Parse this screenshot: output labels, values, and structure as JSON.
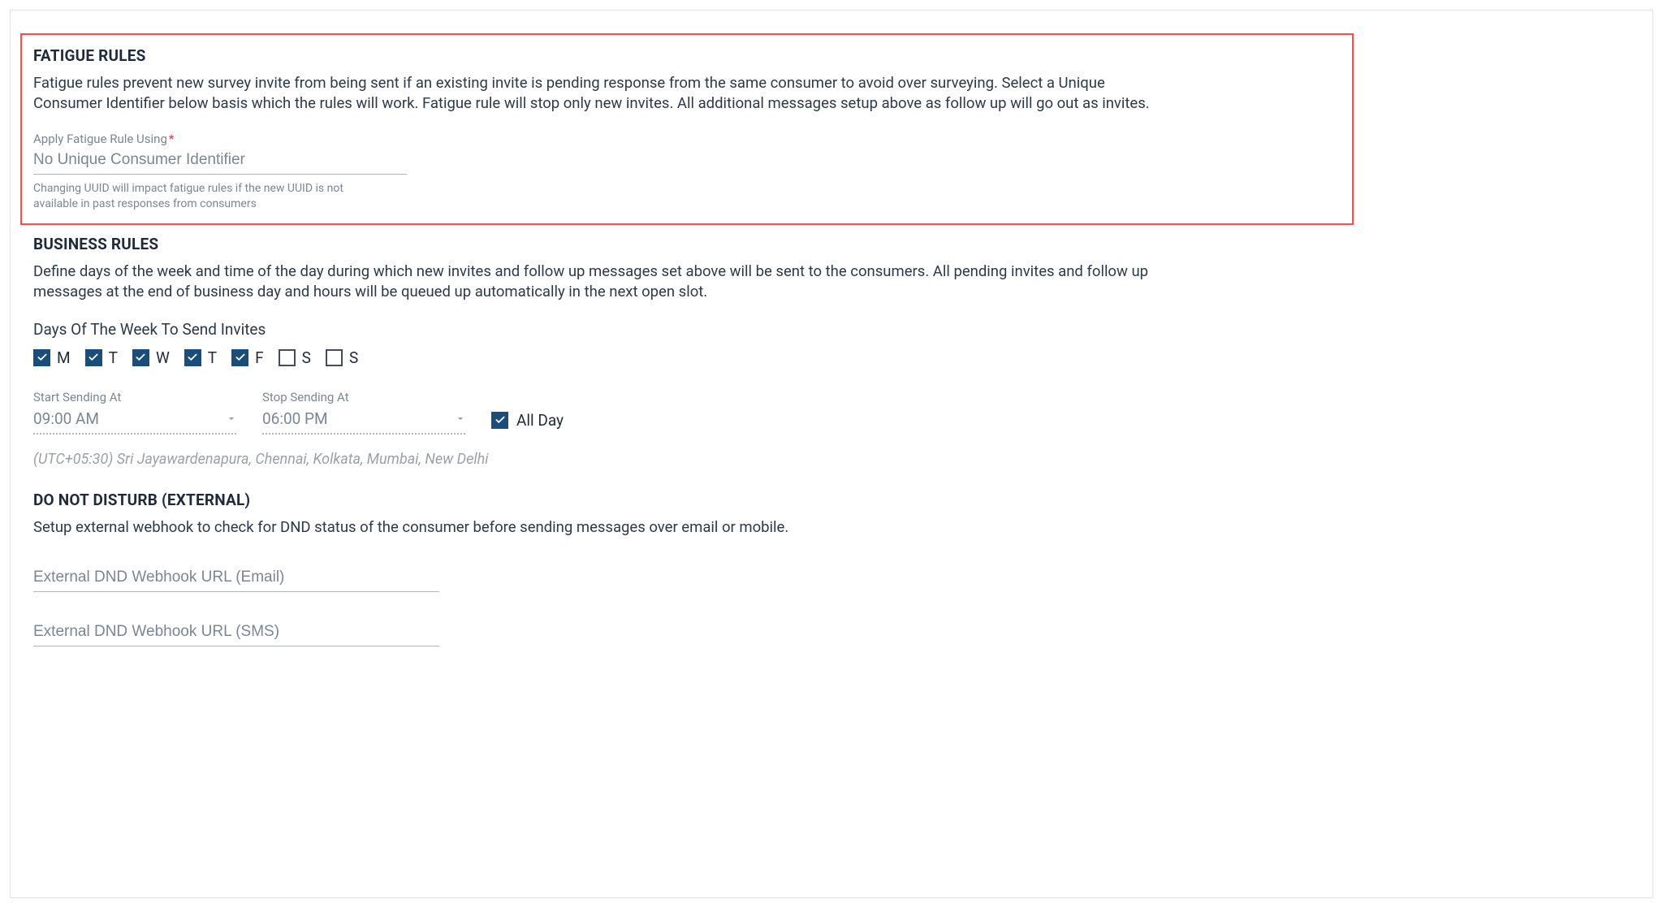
{
  "fatigue": {
    "title": "FATIGUE RULES",
    "description": "Fatigue rules prevent new survey invite from being sent if an existing invite is pending response from the same consumer to avoid over surveying. Select a Unique Consumer Identifier below basis which the rules will work. Fatigue rule will stop only new invites. All additional messages setup above as follow up will go out as invites.",
    "apply_label": "Apply Fatigue Rule Using",
    "apply_placeholder": "No Unique Consumer Identifier",
    "helper": "Changing UUID will impact fatigue rules if the new UUID is not available in past responses from consumers"
  },
  "business": {
    "title": "BUSINESS RULES",
    "description": "Define days of the week and time of the day during which new invites and follow up messages set above will be sent to the consumers. All pending invites and follow up messages at the end of business day and hours will be queued up automatically in the next open slot.",
    "days_label": "Days Of The Week To Send Invites",
    "days": [
      {
        "label": "M",
        "checked": true
      },
      {
        "label": "T",
        "checked": true
      },
      {
        "label": "W",
        "checked": true
      },
      {
        "label": "T",
        "checked": true
      },
      {
        "label": "F",
        "checked": true
      },
      {
        "label": "S",
        "checked": false
      },
      {
        "label": "S",
        "checked": false
      }
    ],
    "start_label": "Start Sending At",
    "start_value": "09:00 AM",
    "stop_label": "Stop Sending At",
    "stop_value": "06:00 PM",
    "all_day_label": "All Day",
    "all_day_checked": true,
    "timezone": "(UTC+05:30) Sri Jayawardenapura, Chennai, Kolkata, Mumbai, New Delhi"
  },
  "dnd": {
    "title": "DO NOT DISTURB (EXTERNAL)",
    "description": "Setup external webhook to check for DND status of the consumer before sending messages over email or mobile.",
    "email_placeholder": "External DND Webhook URL (Email)",
    "sms_placeholder": "External DND Webhook URL (SMS)"
  }
}
